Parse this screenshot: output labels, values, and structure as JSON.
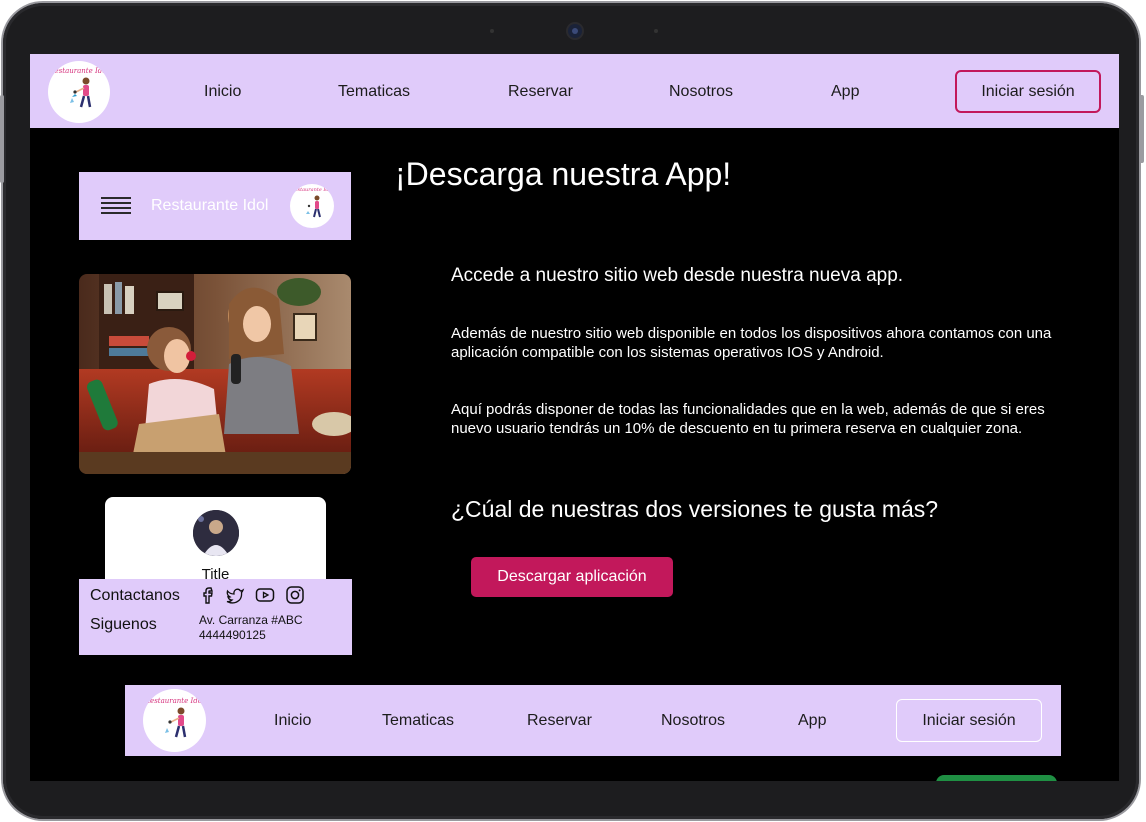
{
  "nav": {
    "logo_text": "Restaurante Idol",
    "items": [
      "Inicio",
      "Tematicas",
      "Reservar",
      "Nosotros",
      "App"
    ],
    "login_label": "Iniciar sesión"
  },
  "sidebar": {
    "menu_title": "Restaurante Idol",
    "card_title": "Title",
    "contact_label": "Contactanos",
    "follow_label": "Siguenos",
    "address": "Av. Carranza #ABC",
    "phone": "4444490125",
    "social_icons": [
      "facebook-icon",
      "twitter-icon",
      "youtube-icon",
      "instagram-icon"
    ]
  },
  "main": {
    "title": "¡Descarga nuestra App!",
    "subtitle": "Accede a nuestro sitio web desde nuestra nueva app.",
    "paragraph1": "Además de nuestro sitio web  disponible en todos los dispositivos ahora contamos con una aplicación compatible con los sistemas operativos IOS y Android.",
    "paragraph2": "Aquí podrás disponer de todas las funcionalidades que en la web, además de que si eres nuevo usuario tendrás un 10% de descuento en tu primera reserva en cualquier zona.",
    "question": "¿Cúal de nuestras dos versiones te gusta más?",
    "download_label": "Descargar aplicación"
  },
  "colors": {
    "nav_bg": "#e0cbfa",
    "accent": "#c2185b",
    "page_bg": "#000000",
    "login_border_top": "#c2185b",
    "login_border_bottom": "#ffffff"
  }
}
